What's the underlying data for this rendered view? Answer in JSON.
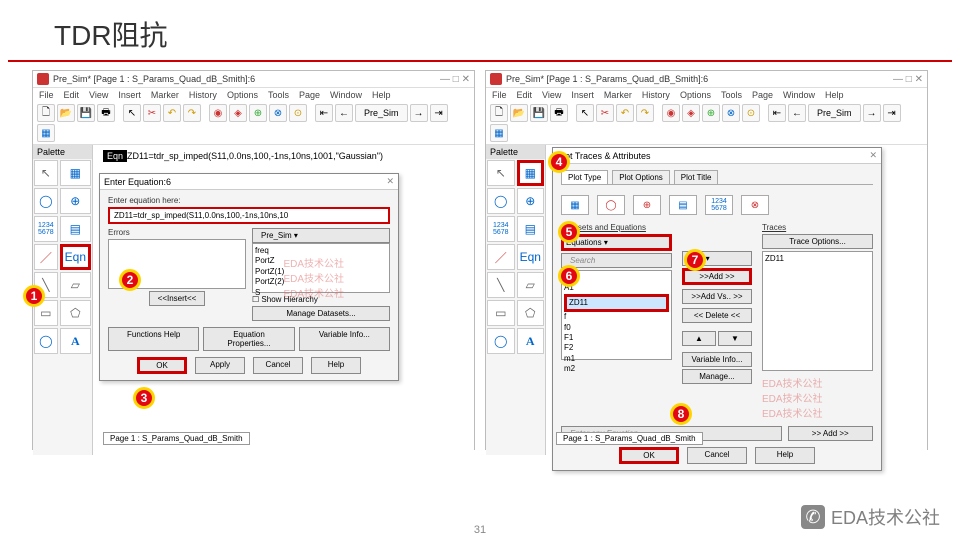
{
  "slide": {
    "title": "TDR阻抗",
    "page_num": "31"
  },
  "brand": {
    "text": "EDA技术公社"
  },
  "window": {
    "title": "Pre_Sim* [Page 1 : S_Params_Quad_dB_Smith]:6",
    "menu": [
      "File",
      "Edit",
      "View",
      "Insert",
      "Marker",
      "History",
      "Options",
      "Tools",
      "Page",
      "Window",
      "Help"
    ],
    "dataset_selector": "Pre_Sim",
    "footer_tab": "Page 1 : S_Params_Quad_dB_Smith"
  },
  "palette": {
    "title": "Palette",
    "eqn_btn": "Eqn"
  },
  "eqn_display": {
    "tag": "Eqn",
    "text": "ZD11=tdr_sp_imped(S11,0.0ns,100,-1ns,10ns,1001,\"Gaussian\")"
  },
  "enter_eq_dialog": {
    "title": "Enter Equation:6",
    "field_label": "Enter equation here:",
    "eqn_input": "ZD11=tdr_sp_imped(S11,0.0ns,100,-1ns,10ns,10",
    "errors_label": "Errors",
    "insert_btn": "<<Insert<<",
    "dataset_combo": "Pre_Sim",
    "list": [
      "freq",
      "PortZ",
      "PortZ(1)",
      "PortZ(2)",
      "S"
    ],
    "show_hierarchy": "Show Hierarchy",
    "manage_datasets": "Manage Datasets...",
    "functions_help": "Functions Help",
    "equation_props": "Equation Properties...",
    "variable_info": "Variable Info...",
    "ok": "OK",
    "apply": "Apply",
    "cancel": "Cancel",
    "help": "Help"
  },
  "plot_dialog": {
    "title": "Plot Traces & Attributes",
    "tabs": [
      "Plot Type",
      "Plot Options",
      "Plot Title"
    ],
    "section_label": "Datasets and Equations",
    "traces_label": "Traces",
    "trace_options": "Trace Options...",
    "source_combo": "Equations",
    "search_placeholder": "Search",
    "list_combo": "List",
    "trace_value": "ZD11",
    "avail_list": [
      "A0",
      "A1",
      "ZD11",
      "f",
      "f0",
      "F1",
      "F2",
      "m1",
      "m2"
    ],
    "add_btn": ">>Add >>",
    "add_vs_btn": ">>Add Vs.. >>",
    "delete_btn": "<< Delete <<",
    "up": "▲",
    "down": "▼",
    "variable_info": "Variable Info...",
    "manage": "Manage...",
    "enter_eq_placeholder": "Enter any Equation",
    "add2": ">> Add >>",
    "ok": "OK",
    "cancel": "Cancel",
    "help": "Help"
  },
  "watermark": "EDA技术公社"
}
